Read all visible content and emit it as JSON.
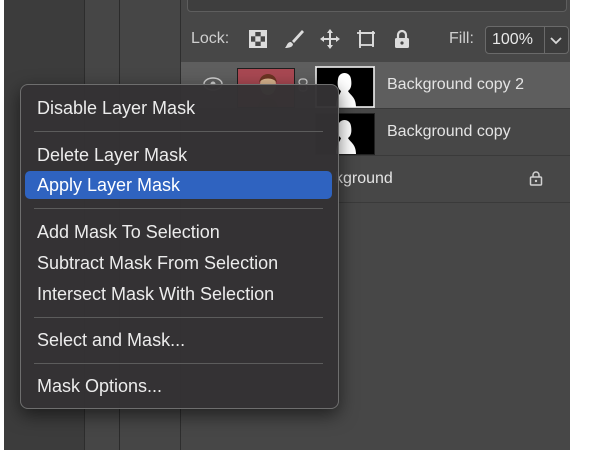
{
  "lock_row": {
    "label": "Lock:",
    "icons": [
      "lock-transparent-pixels-icon",
      "lock-image-pixels-icon",
      "lock-position-icon",
      "lock-artboard-icon",
      "lock-all-icon"
    ],
    "fill_label": "Fill:",
    "fill_value": "100%"
  },
  "layers": [
    {
      "name": "Background copy 2",
      "selected": true,
      "visible": true,
      "has_mask": true
    },
    {
      "name": "Background copy",
      "selected": false,
      "visible": true,
      "has_mask": true
    },
    {
      "name": "Background",
      "visible_text": "kground",
      "selected": false,
      "locked": true
    }
  ],
  "context_menu": {
    "items": [
      {
        "label": "Disable Layer Mask"
      },
      {
        "label": "Delete Layer Mask"
      },
      {
        "label": "Apply Layer Mask",
        "highlighted": true
      },
      {
        "label": "Add Mask To Selection"
      },
      {
        "label": "Subtract Mask From Selection"
      },
      {
        "label": "Intersect Mask With Selection"
      },
      {
        "label": "Select and Mask..."
      },
      {
        "label": "Mask Options..."
      }
    ]
  },
  "colors": {
    "menu_highlight": "#2f63c0",
    "selected_layer": "#5e5e5e",
    "panel_bg": "#474747"
  }
}
